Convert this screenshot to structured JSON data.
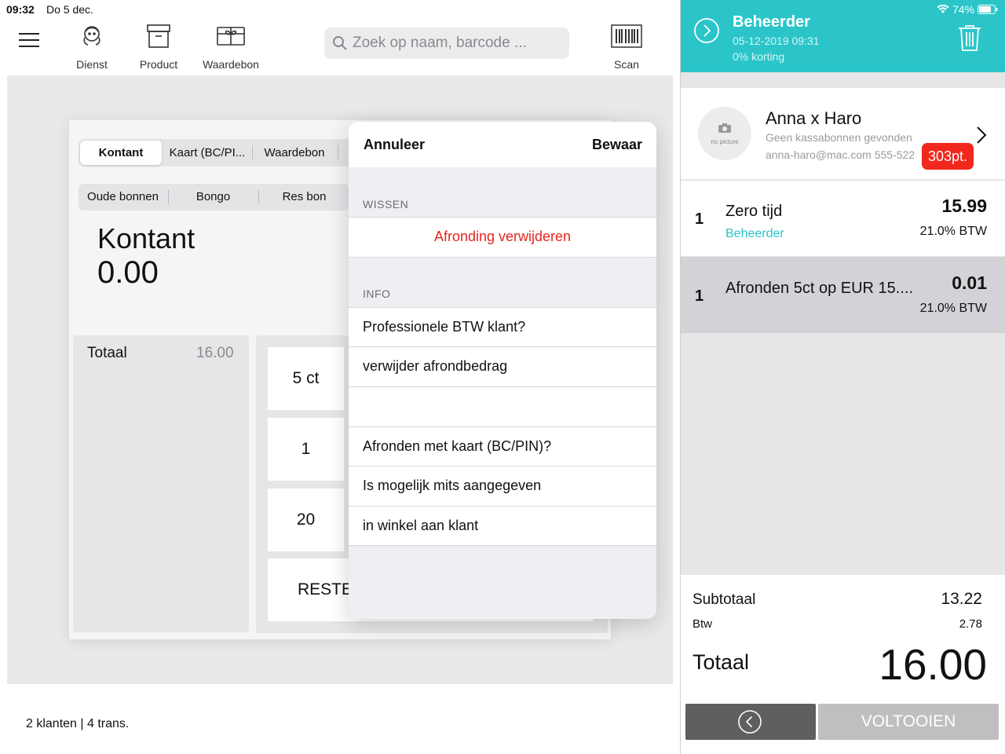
{
  "statusbar": {
    "time": "09:32",
    "date": "Do 5 dec.",
    "battery": "74%"
  },
  "toolbar": {
    "items": [
      {
        "label": "Dienst",
        "icon": "service-icon"
      },
      {
        "label": "Product",
        "icon": "product-box-icon"
      },
      {
        "label": "Waardebon",
        "icon": "gift-card-icon"
      }
    ],
    "search_placeholder": "Zoek op naam, barcode ...",
    "scan_label": "Scan"
  },
  "payment": {
    "methods": [
      "Kontant",
      "Kaart (BC/PI...",
      "Waardebon"
    ],
    "selected": "Kontant",
    "vouchers": [
      "Oude bonnen",
      "Bongo",
      "Res bon"
    ],
    "title": "Kontant",
    "amount": "0.00",
    "total_label": "Totaal",
    "total_value": "16.00",
    "keys": [
      "5 ct",
      "1",
      "20",
      "RESTE"
    ]
  },
  "popover": {
    "cancel": "Annuleer",
    "save": "Bewaar",
    "section_clear": "WISSEN",
    "clear_action": "Afronding verwijderen",
    "section_info": "INFO",
    "info_rows": [
      "Professionele BTW klant?",
      "verwijder afrondbedrag",
      "",
      "Afronden met kaart (BC/PIN)?",
      "Is mogelijk mits aangegeven",
      "in winkel aan klant"
    ]
  },
  "footer": {
    "text": "2 klanten | 4 trans."
  },
  "order": {
    "user": "Beheerder",
    "date": "05-12-2019 09:31",
    "discount": "0% korting",
    "customer": {
      "avatar_text": "no picture",
      "name": "Anna x Haro",
      "subtitle": "Geen kassabonnen gevonden",
      "contact": "anna-haro@mac.com 555-522",
      "points": "303pt."
    },
    "lines": [
      {
        "qty": "1",
        "name": "Zero tijd",
        "sub": "Beheerder",
        "price": "15.99",
        "vat": "21.0% BTW"
      },
      {
        "qty": "1",
        "name": "Afronden 5ct op EUR 15....",
        "sub": "",
        "price": "0.01",
        "vat": "21.0% BTW"
      }
    ],
    "subtotal_label": "Subtotaal",
    "subtotal": "13.22",
    "vat_label": "Btw",
    "vat": "2.78",
    "total_label": "Totaal",
    "total": "16.00",
    "complete_label": "VOLTOOIEN"
  },
  "colors": {
    "accent": "#2bc5c9",
    "danger": "#e5251d",
    "badge": "#f2281e"
  }
}
